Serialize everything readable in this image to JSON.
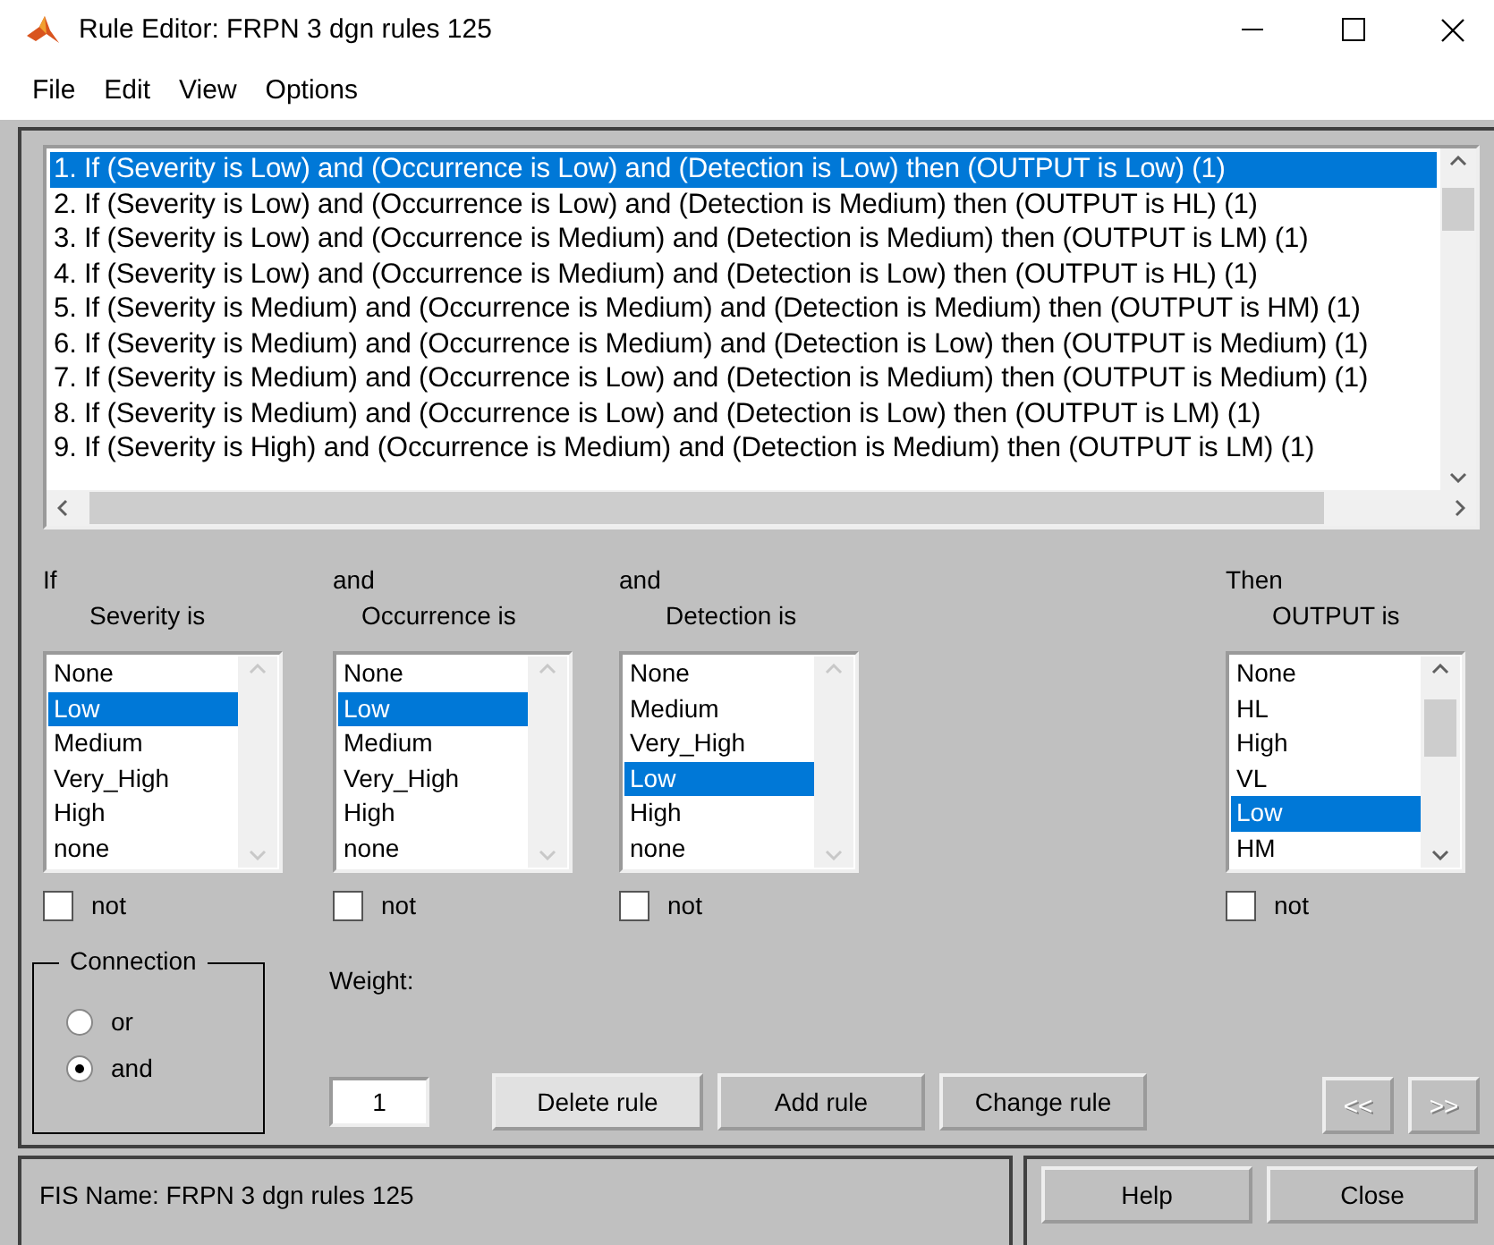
{
  "window": {
    "title": "Rule Editor: FRPN 3 dgn rules 125"
  },
  "menu": [
    "File",
    "Edit",
    "View",
    "Options"
  ],
  "rules": [
    {
      "text": "1. If (Severity is Low) and (Occurrence is Low) and (Detection is Low) then (OUTPUT is Low) (1)",
      "selected": true
    },
    {
      "text": "2. If (Severity is Low) and (Occurrence is Low) and (Detection is Medium) then (OUTPUT is HL) (1)",
      "selected": false
    },
    {
      "text": "3. If (Severity is Low) and (Occurrence is Medium) and (Detection is Medium) then (OUTPUT is LM) (1)",
      "selected": false
    },
    {
      "text": "4. If (Severity is Low) and (Occurrence is Medium) and (Detection is Low) then (OUTPUT is HL) (1)",
      "selected": false
    },
    {
      "text": "5. If (Severity is Medium) and (Occurrence is Medium) and (Detection is Medium) then (OUTPUT is HM) (1)",
      "selected": false
    },
    {
      "text": "6. If (Severity is Medium) and (Occurrence is Medium) and (Detection is Low) then (OUTPUT is Medium) (1)",
      "selected": false
    },
    {
      "text": "7. If (Severity is Medium) and (Occurrence is Low) and (Detection is Medium) then (OUTPUT is Medium) (1)",
      "selected": false
    },
    {
      "text": "8. If (Severity is Medium) and (Occurrence is Low) and (Detection is Low) then (OUTPUT is LM) (1)",
      "selected": false
    },
    {
      "text": "9. If (Severity is High) and (Occurrence is Medium) and (Detection is Medium) then (OUTPUT is LM) (1)",
      "selected": false
    }
  ],
  "conditions": [
    {
      "connector": "If",
      "label": "Severity is",
      "not_label": "not",
      "not_checked": false,
      "options": [
        {
          "label": "None",
          "selected": false
        },
        {
          "label": "Low",
          "selected": true
        },
        {
          "label": "Medium",
          "selected": false
        },
        {
          "label": "Very_High",
          "selected": false
        },
        {
          "label": "High",
          "selected": false
        },
        {
          "label": "none",
          "selected": false
        }
      ]
    },
    {
      "connector": "and",
      "label": "Occurrence is",
      "not_label": "not",
      "not_checked": false,
      "options": [
        {
          "label": "None",
          "selected": false
        },
        {
          "label": "Low",
          "selected": true
        },
        {
          "label": "Medium",
          "selected": false
        },
        {
          "label": "Very_High",
          "selected": false
        },
        {
          "label": "High",
          "selected": false
        },
        {
          "label": "none",
          "selected": false
        }
      ]
    },
    {
      "connector": "and",
      "label": "Detection is",
      "not_label": "not",
      "not_checked": false,
      "options": [
        {
          "label": "None",
          "selected": false
        },
        {
          "label": "Medium",
          "selected": false
        },
        {
          "label": "Very_High",
          "selected": false
        },
        {
          "label": "Low",
          "selected": true
        },
        {
          "label": "High",
          "selected": false
        },
        {
          "label": "none",
          "selected": false
        }
      ]
    }
  ],
  "output": {
    "connector": "Then",
    "label": "OUTPUT is",
    "not_label": "not",
    "not_checked": false,
    "options": [
      {
        "label": "None",
        "selected": false
      },
      {
        "label": "HL",
        "selected": false
      },
      {
        "label": "High",
        "selected": false
      },
      {
        "label": "VL",
        "selected": false
      },
      {
        "label": "Low",
        "selected": true
      },
      {
        "label": "HM",
        "selected": false
      }
    ]
  },
  "connection": {
    "title": "Connection",
    "options": [
      {
        "label": "or",
        "selected": false
      },
      {
        "label": "and",
        "selected": true
      }
    ]
  },
  "weight": {
    "label": "Weight:",
    "value": "1"
  },
  "buttons": [
    "Delete rule",
    "Add rule",
    "Change rule"
  ],
  "nav_buttons": [
    {
      "label": "<<",
      "disabled": true
    },
    {
      "label": ">>",
      "disabled": true
    }
  ],
  "status": "FIS Name: FRPN 3 dgn rules 125",
  "footer_buttons": [
    "Help",
    "Close"
  ]
}
